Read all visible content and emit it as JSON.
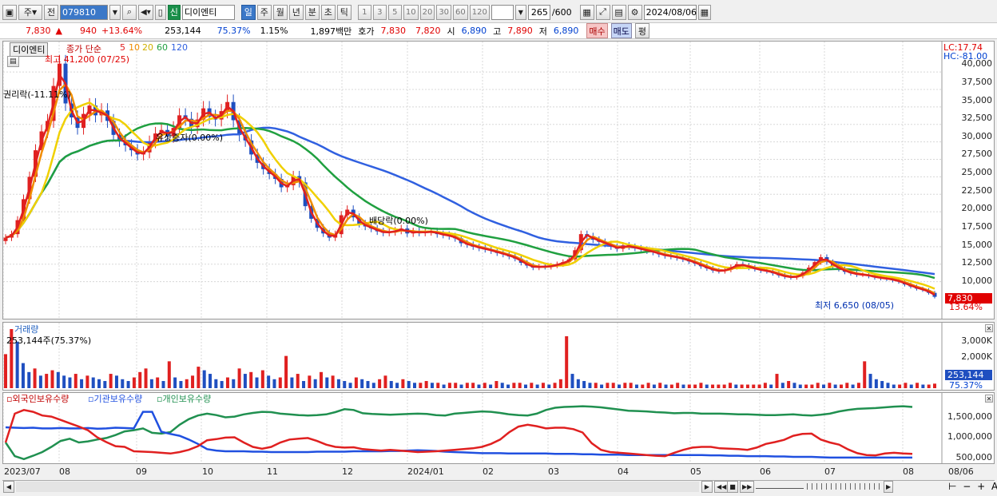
{
  "toolbar": {
    "period_type": "주",
    "prev_label": "전",
    "code": "079810",
    "mode_tag": "신",
    "stock_name": "디이엔티",
    "period_tabs": [
      "일",
      "주",
      "월",
      "년",
      "분",
      "초",
      "틱"
    ],
    "interval_buttons": [
      "1",
      "3",
      "5",
      "10",
      "20",
      "30",
      "60",
      "120"
    ],
    "count_value": "265",
    "count_max": "/600",
    "date_value": "2024/08/06"
  },
  "quote": {
    "price": "7,830",
    "arrow": "▲",
    "change": "940",
    "change_pct": "+13.64%",
    "volume": "253,144",
    "volume_ratio": "75.37%",
    "turnover": "1.15%",
    "amount": "1,897백만",
    "bid_label": "호가",
    "ask_price": "7,830",
    "bid_price": "7,820",
    "open_label": "시",
    "open": "6,890",
    "high_label": "고",
    "high": "7,890",
    "low_label": "저",
    "low": "6,890",
    "buy_label": "매수",
    "sell_label": "매도",
    "avg_label": "평"
  },
  "chart_data": [
    {
      "type": "line",
      "panel": "price",
      "name_tag": "디이엔티",
      "legend_prefix": "종가 단순",
      "ma_periods": [
        "5",
        "10",
        "20",
        "60",
        "120"
      ],
      "ma_colors": [
        "#e02020",
        "#f08c00",
        "#f0d000",
        "#20a040",
        "#3060e0"
      ],
      "lc_label": "LC:17.74",
      "hc_label": "HC:-81.00",
      "y_ticks": [
        "40,000",
        "37,500",
        "35,000",
        "32,500",
        "30,000",
        "27,500",
        "25,000",
        "22,500",
        "20,000",
        "17,500",
        "15,000",
        "12,500",
        "10,000"
      ],
      "ylim": [
        5500,
        41500
      ],
      "x_ticks": [
        "2023/07",
        "08",
        "09",
        "10",
        "11",
        "12",
        "2024/01",
        "02",
        "03",
        "04",
        "05",
        "06",
        "07",
        "08",
        "08/06"
      ],
      "current_price_label": "7,830",
      "current_pct_label": "13.64%",
      "annotations": {
        "high": "최고 41,200 (07/25)",
        "low": "최저 6,650 (08/05)",
        "ex_rights": "권리락(-11.11%)",
        "rights_issue": "유상증자(0.00%)",
        "ex_dividend": "배당락(0.00%)"
      },
      "close_series": [
        16300,
        16800,
        18800,
        21800,
        25000,
        28800,
        31500,
        33000,
        38000,
        41200,
        35500,
        33500,
        32000,
        34000,
        35200,
        33800,
        34500,
        33000,
        31000,
        30200,
        29500,
        28800,
        28200,
        28500,
        30000,
        31200,
        31700,
        30800,
        32000,
        33800,
        33300,
        32100,
        33200,
        34800,
        33600,
        33200,
        34400,
        35700,
        33100,
        31000,
        30200,
        28200,
        27000,
        26100,
        25400,
        24700,
        23500,
        23800,
        25100,
        24200,
        20800,
        19000,
        17700,
        16900,
        16300,
        16800,
        19500,
        20300,
        19200,
        18300,
        17900,
        17600,
        17200,
        17000,
        17100,
        17300,
        17600,
        16900,
        17200,
        17000,
        17100,
        17200,
        16800,
        16700,
        16500,
        16200,
        15500,
        15300,
        15000,
        14800,
        14600,
        14400,
        14100,
        13900,
        13600,
        13300,
        12700,
        12300,
        12000,
        12200,
        12100,
        12300,
        12500,
        12800,
        13200,
        14500,
        16800,
        16500,
        16000,
        15700,
        15400,
        15000,
        14700,
        15200,
        15000,
        14800,
        14600,
        14400,
        14200,
        13900,
        13700,
        13600,
        13400,
        13200,
        12900,
        12600,
        12200,
        11900,
        11600,
        11500,
        11700,
        12100,
        12500,
        12300,
        12000,
        11800,
        11600,
        11500,
        11200,
        10900,
        10700,
        10600,
        10800,
        11300,
        12000,
        12800,
        13500,
        12800,
        12200,
        11800,
        11400,
        11200,
        11000,
        11000,
        10800,
        10600,
        10500,
        10400,
        10200,
        10000,
        9600,
        9300,
        9000,
        8800,
        8400,
        7830
      ]
    },
    {
      "type": "bar",
      "panel": "volume",
      "title": "거래량",
      "current_label": "253,144주(75.37%)",
      "y_ticks": [
        "3,000K",
        "2,000K"
      ],
      "current_value_label": "253,144",
      "current_pct_label": "75.37%",
      "ylim": [
        0,
        3300
      ],
      "unit": "K",
      "values": [
        1900,
        3300,
        2600,
        1400,
        900,
        1100,
        700,
        800,
        1000,
        900,
        700,
        600,
        800,
        500,
        700,
        600,
        500,
        400,
        800,
        700,
        500,
        400,
        600,
        900,
        1100,
        500,
        600,
        400,
        1500,
        600,
        400,
        500,
        700,
        1200,
        1000,
        800,
        500,
        400,
        600,
        500,
        1100,
        800,
        900,
        600,
        1000,
        700,
        500,
        600,
        1800,
        600,
        800,
        400,
        700,
        500,
        900,
        600,
        700,
        500,
        400,
        300,
        600,
        500,
        400,
        300,
        500,
        700,
        400,
        300,
        500,
        400,
        300,
        300,
        400,
        300,
        300,
        200,
        300,
        300,
        200,
        300,
        300,
        200,
        300,
        200,
        400,
        300,
        200,
        300,
        300,
        200,
        300,
        200,
        300,
        200,
        300,
        500,
        2900,
        800,
        500,
        400,
        300,
        300,
        200,
        300,
        300,
        200,
        300,
        300,
        200,
        200,
        300,
        200,
        300,
        200,
        200,
        300,
        200,
        200,
        200,
        300,
        200,
        200,
        200,
        200,
        300,
        200,
        200,
        200,
        200,
        200,
        300,
        200,
        800,
        300,
        400,
        300,
        200,
        200,
        200,
        300,
        200,
        300,
        200,
        200,
        300,
        200,
        300,
        1500,
        800,
        500,
        400,
        300,
        200,
        200,
        300,
        200,
        300,
        200,
        200,
        253
      ]
    },
    {
      "type": "line",
      "panel": "holdings",
      "series_names": [
        "외국인보유수량",
        "기관보유수량",
        "개인보유수량"
      ],
      "series_colors": [
        "#e02020",
        "#2050e0",
        "#209050"
      ],
      "y_ticks": [
        "1,500,000",
        "1,000,000",
        "500,000"
      ],
      "ylim": [
        300000,
        1900000
      ],
      "foreign": [
        820000,
        1600000,
        1700000,
        1650000,
        1550000,
        1520000,
        1430000,
        1340000,
        1250000,
        1150000,
        960000,
        830000,
        720000,
        700000,
        580000,
        570000,
        560000,
        540000,
        520000,
        560000,
        620000,
        720000,
        880000,
        910000,
        950000,
        960000,
        820000,
        700000,
        650000,
        700000,
        820000,
        900000,
        920000,
        940000,
        860000,
        760000,
        700000,
        680000,
        690000,
        640000,
        620000,
        600000,
        620000,
        600000,
        580000,
        560000,
        570000,
        580000,
        600000,
        620000,
        640000,
        660000,
        700000,
        780000,
        900000,
        1100000,
        1250000,
        1300000,
        1260000,
        1200000,
        1220000,
        1220000,
        1180000,
        1090000,
        800000,
        620000,
        560000,
        540000,
        520000,
        500000,
        480000,
        460000,
        450000,
        540000,
        620000,
        680000,
        700000,
        700000,
        660000,
        650000,
        640000,
        620000,
        680000,
        780000,
        830000,
        890000,
        1000000,
        1050000,
        1060000,
        900000,
        820000,
        760000,
        630000,
        530000,
        480000,
        470000,
        520000,
        540000,
        520000,
        510000
      ],
      "institution": [
        1230000,
        1220000,
        1210000,
        1220000,
        1200000,
        1200000,
        1210000,
        1200000,
        1200000,
        1210000,
        1190000,
        1200000,
        1220000,
        1210000,
        1200000,
        1650000,
        1650000,
        1110000,
        1050000,
        1000000,
        900000,
        780000,
        640000,
        600000,
        580000,
        580000,
        580000,
        570000,
        570000,
        560000,
        560000,
        560000,
        560000,
        560000,
        570000,
        570000,
        570000,
        570000,
        580000,
        580000,
        580000,
        580000,
        590000,
        590000,
        600000,
        610000,
        600000,
        590000,
        570000,
        560000,
        550000,
        540000,
        530000,
        530000,
        530000,
        520000,
        520000,
        520000,
        520000,
        520000,
        510000,
        510000,
        510000,
        500000,
        500000,
        490000,
        490000,
        490000,
        480000,
        480000,
        480000,
        480000,
        480000,
        480000,
        480000,
        480000,
        480000,
        470000,
        470000,
        460000,
        460000,
        450000,
        450000,
        450000,
        440000,
        440000,
        430000,
        430000,
        430000,
        420000,
        410000,
        410000,
        410000,
        410000,
        410000,
        410000,
        410000,
        410000,
        410000,
        410000
      ],
      "individual": [
        820000,
        450000,
        370000,
        460000,
        560000,
        700000,
        860000,
        920000,
        820000,
        850000,
        900000,
        940000,
        1020000,
        1120000,
        1150000,
        1200000,
        1080000,
        1060000,
        1100000,
        1300000,
        1450000,
        1550000,
        1600000,
        1560000,
        1500000,
        1520000,
        1580000,
        1620000,
        1650000,
        1640000,
        1600000,
        1580000,
        1560000,
        1550000,
        1560000,
        1580000,
        1640000,
        1720000,
        1700000,
        1610000,
        1590000,
        1580000,
        1570000,
        1580000,
        1590000,
        1600000,
        1590000,
        1560000,
        1550000,
        1600000,
        1620000,
        1640000,
        1660000,
        1650000,
        1620000,
        1580000,
        1560000,
        1550000,
        1600000,
        1700000,
        1760000,
        1780000,
        1790000,
        1800000,
        1790000,
        1770000,
        1740000,
        1710000,
        1680000,
        1670000,
        1660000,
        1640000,
        1630000,
        1610000,
        1620000,
        1620000,
        1600000,
        1600000,
        1600000,
        1590000,
        1580000,
        1580000,
        1570000,
        1560000,
        1560000,
        1570000,
        1580000,
        1560000,
        1550000,
        1570000,
        1600000,
        1660000,
        1700000,
        1730000,
        1740000,
        1750000,
        1770000,
        1790000,
        1800000,
        1780000
      ]
    }
  ]
}
